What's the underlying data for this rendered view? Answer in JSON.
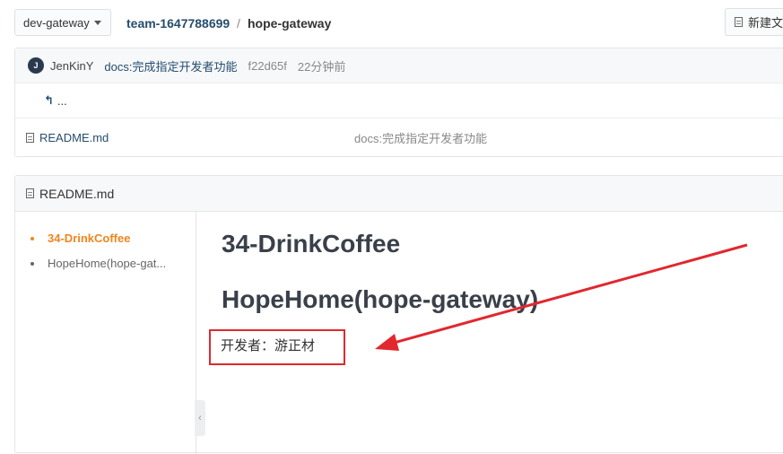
{
  "header": {
    "branch": "dev-gateway",
    "owner": "team-1647788699",
    "separator": "/",
    "repo": "hope-gateway",
    "new_file_label": "新建文件"
  },
  "commit": {
    "avatar_initial": "J",
    "author": "JenKinY",
    "message": "docs:完成指定开发者功能",
    "sha": "f22d65f",
    "time": "22分钟前"
  },
  "back_row": {
    "label": "..."
  },
  "files": [
    {
      "name": "README.md",
      "commit_message": "docs:完成指定开发者功能"
    }
  ],
  "readme": {
    "title": "README.md",
    "toc": [
      "34-DrinkCoffee",
      "HopeHome(hope-gat..."
    ],
    "heading1": "34-DrinkCoffee",
    "heading2": "HopeHome(hope-gateway)",
    "paragraph": "开发者：游正材"
  },
  "colors": {
    "link": "#264d6e",
    "toc_active": "#f0851d",
    "annotation": "#e0282e"
  },
  "icons": [
    "chevron-down-icon",
    "file-icon",
    "back-arrow-icon",
    "collapse-chevron-icon"
  ]
}
